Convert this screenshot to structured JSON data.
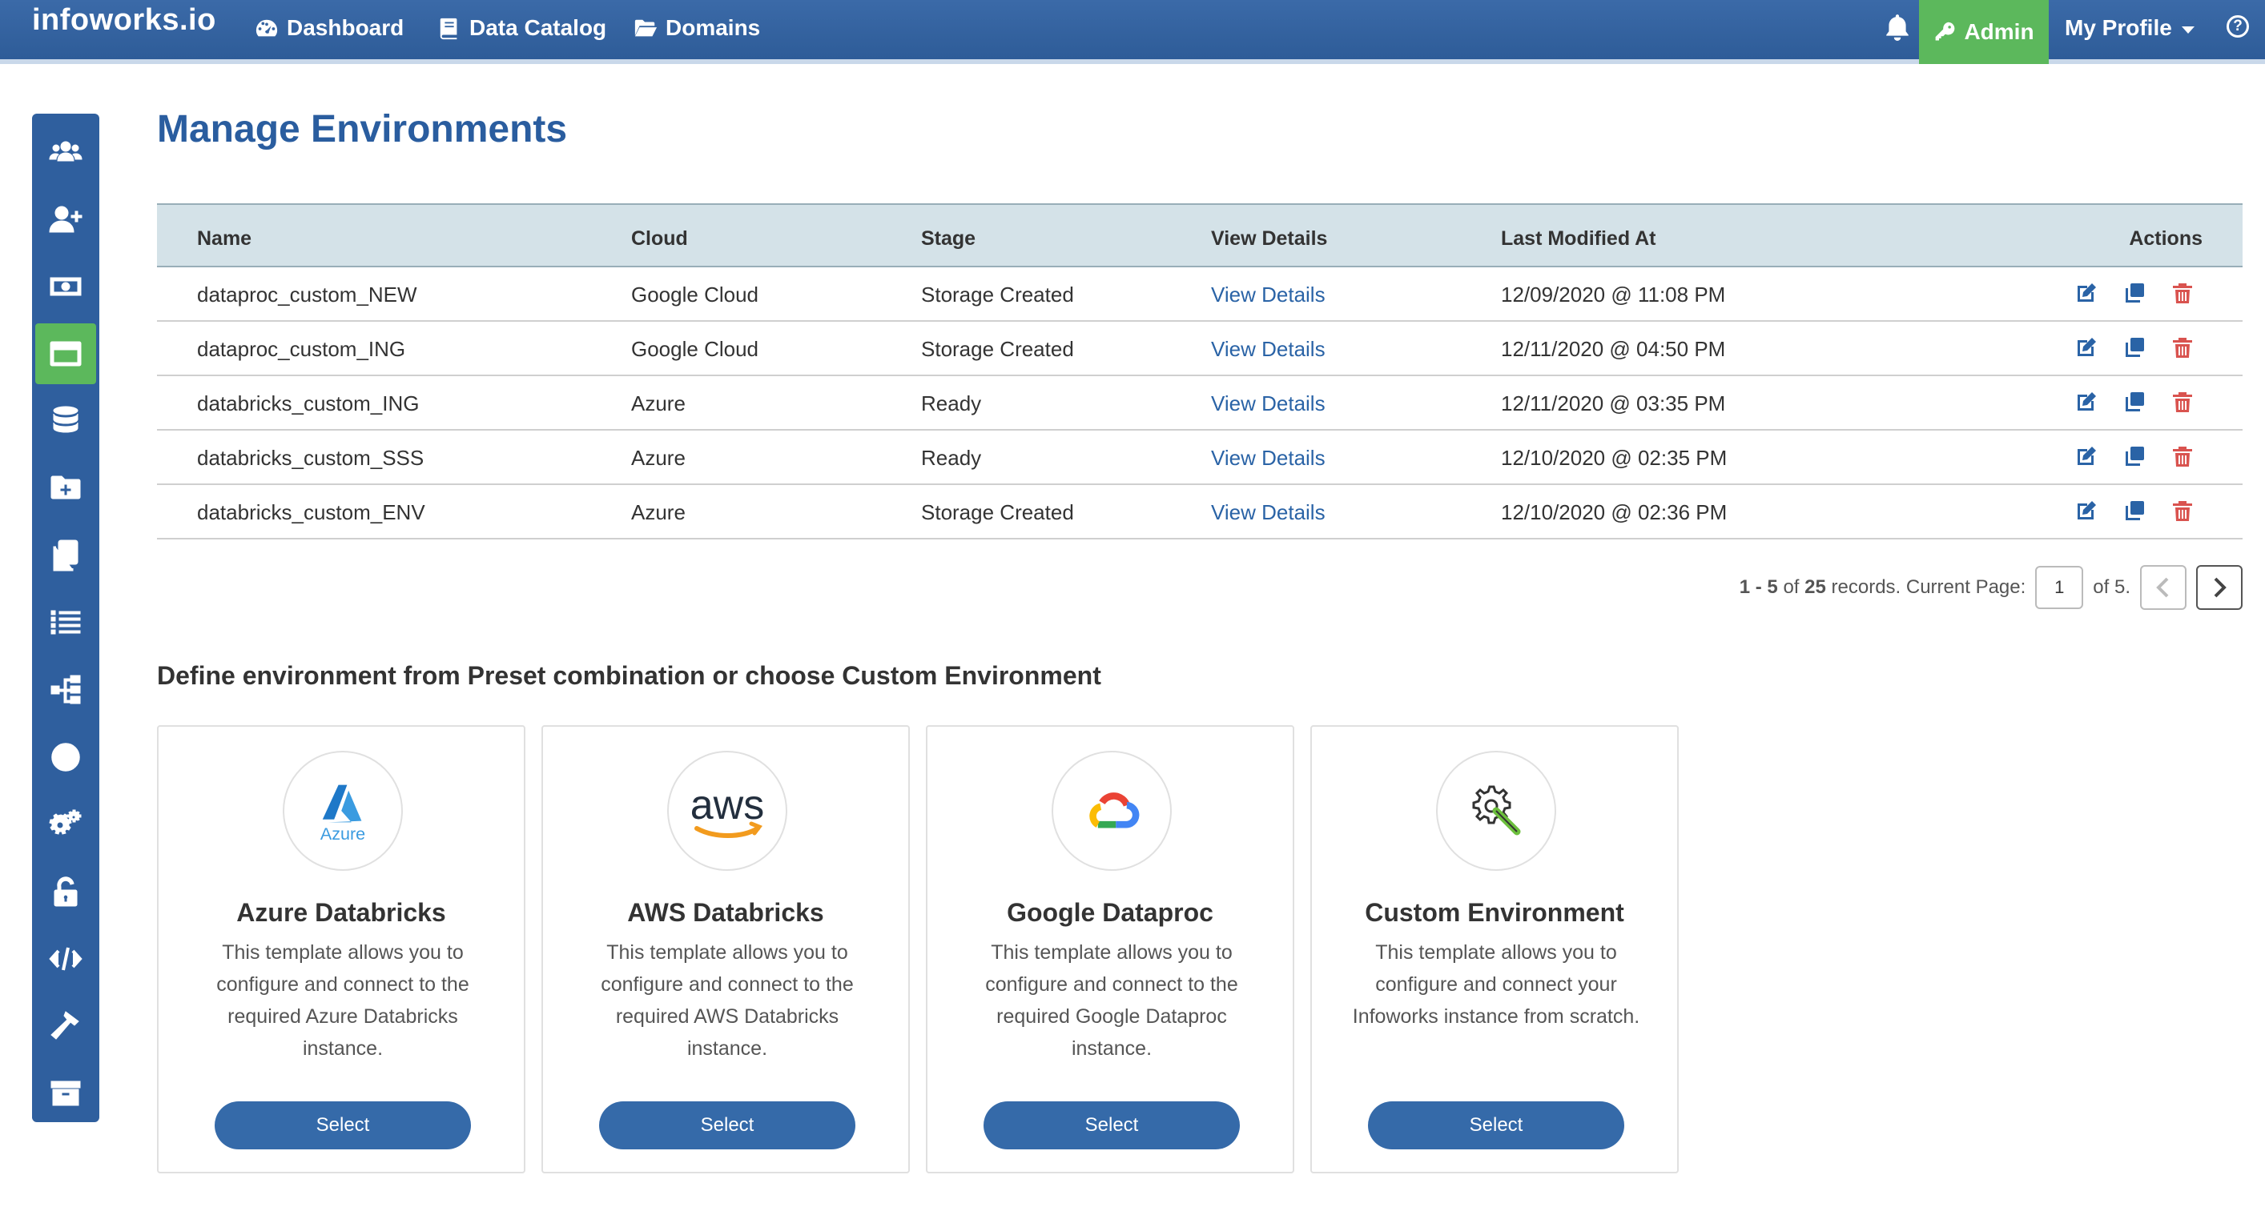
{
  "header": {
    "brand": "infoworks.io",
    "nav": [
      {
        "label": "Dashboard",
        "icon": "gauge-icon"
      },
      {
        "label": "Data Catalog",
        "icon": "book-icon"
      },
      {
        "label": "Domains",
        "icon": "folder-open-icon"
      }
    ],
    "admin_label": "Admin",
    "profile_label": "My Profile",
    "help_glyph": "?"
  },
  "sidebar": {
    "items": [
      {
        "icon": "users-icon",
        "active": false
      },
      {
        "icon": "user-plus-icon",
        "active": false
      },
      {
        "icon": "money-icon",
        "active": false
      },
      {
        "icon": "window-icon",
        "active": true
      },
      {
        "icon": "database-icon",
        "active": false
      },
      {
        "icon": "folder-plus-icon",
        "active": false
      },
      {
        "icon": "copy-icon",
        "active": false
      },
      {
        "icon": "list-icon",
        "active": false
      },
      {
        "icon": "sitemap-icon",
        "active": false
      },
      {
        "icon": "clock-icon",
        "active": false
      },
      {
        "icon": "gears-icon",
        "active": false
      },
      {
        "icon": "unlock-icon",
        "active": false
      },
      {
        "icon": "code-icon",
        "active": false
      },
      {
        "icon": "hammer-icon",
        "active": false
      },
      {
        "icon": "archive-icon",
        "active": false
      }
    ]
  },
  "main": {
    "title": "Manage Environments",
    "table": {
      "columns": [
        "Name",
        "Cloud",
        "Stage",
        "View Details",
        "Last Modified At",
        "Actions"
      ],
      "rows": [
        {
          "name": "dataproc_custom_NEW",
          "cloud": "Google Cloud",
          "stage": "Storage Created",
          "view": "View Details",
          "modified": "12/09/2020 @ 11:08 PM"
        },
        {
          "name": "dataproc_custom_ING",
          "cloud": "Google Cloud",
          "stage": "Storage Created",
          "view": "View Details",
          "modified": "12/11/2020 @ 04:50 PM"
        },
        {
          "name": "databricks_custom_ING",
          "cloud": "Azure",
          "stage": "Ready",
          "view": "View Details",
          "modified": "12/11/2020 @ 03:35 PM"
        },
        {
          "name": "databricks_custom_SSS",
          "cloud": "Azure",
          "stage": "Ready",
          "view": "View Details",
          "modified": "12/10/2020 @ 02:35 PM"
        },
        {
          "name": "databricks_custom_ENV",
          "cloud": "Azure",
          "stage": "Storage Created",
          "view": "View Details",
          "modified": "12/10/2020 @ 02:36 PM"
        }
      ],
      "row_actions": [
        "edit-icon",
        "clone-icon",
        "delete-icon"
      ]
    },
    "pagination": {
      "range": "1 - 5",
      "of_word": "of",
      "total": "25",
      "records_text": "records. Current Page:",
      "current_page": "1",
      "of_pages": "of 5."
    },
    "section_title": "Define environment from Preset combination or choose Custom Environment",
    "cards": [
      {
        "title": "Azure Databricks",
        "description": "This template allows you to configure and connect to the required Azure Databricks instance.",
        "button": "Select",
        "logo": "azure-logo",
        "logo_text": "Azure"
      },
      {
        "title": "AWS Databricks",
        "description": "This template allows you to configure and connect to the required AWS Databricks instance.",
        "button": "Select",
        "logo": "aws-logo",
        "logo_text": "aws"
      },
      {
        "title": "Google Dataproc",
        "description": "This template allows you to configure and connect to the required Google Dataproc instance.",
        "button": "Select",
        "logo": "google-cloud-logo"
      },
      {
        "title": "Custom Environment",
        "description": "This template allows you to configure and connect your Infoworks instance from scratch.",
        "button": "Select",
        "logo": "wrench-gear-logo"
      }
    ]
  },
  "colors": {
    "nav_bg": "#2e5c98",
    "admin_active": "#5cb85c",
    "title_blue": "#2a5d9f",
    "link_blue": "#2a63a6",
    "button_blue": "#356aa9",
    "table_header_bg": "#d4e2e8",
    "delete_red": "#d9534f"
  }
}
